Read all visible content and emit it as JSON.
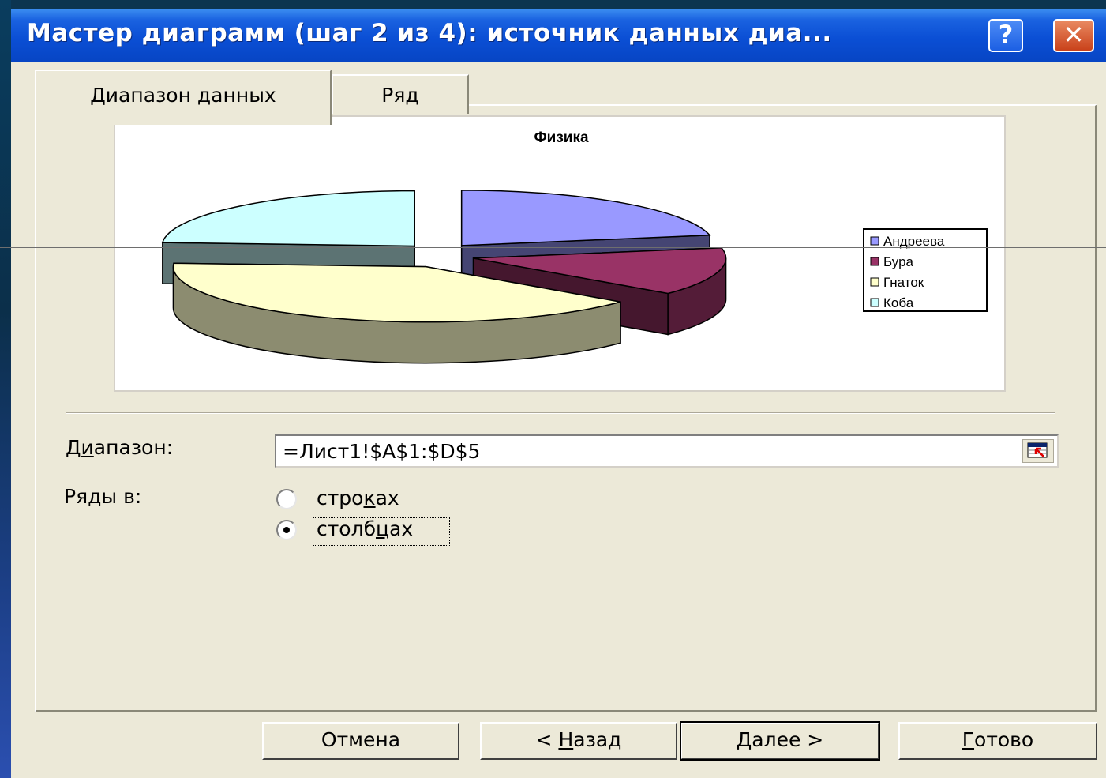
{
  "window": {
    "title": "Мастер диаграмм (шаг 2 из 4): источник данных диа...",
    "help_glyph": "?",
    "close_glyph": "✕"
  },
  "tabs": [
    {
      "label": "Диапазон данных",
      "active": true
    },
    {
      "label": "Ряд",
      "active": false
    }
  ],
  "chart_data": {
    "type": "pie",
    "title": "Физика",
    "style": "3d-exploded",
    "legend_position": "right",
    "slices": [
      {
        "name": "Андреева",
        "value": 22,
        "color": "#9999ff"
      },
      {
        "name": "Бура",
        "value": 14,
        "color": "#993366"
      },
      {
        "name": "Гнаток",
        "value": 40,
        "color": "#ffffcc"
      },
      {
        "name": "Коба",
        "value": 24,
        "color": "#ccffff"
      }
    ]
  },
  "form": {
    "range_label_pre": "Д",
    "range_label_u": "и",
    "range_label_post": "апазон:",
    "range_value": "=Лист1!$A$1:$D$5",
    "series_label": "Ряды в:",
    "options": [
      {
        "pre": "стро",
        "u": "к",
        "post": "ах",
        "selected": false
      },
      {
        "pre": "столб",
        "u": "ц",
        "post": "ах",
        "selected": true
      }
    ]
  },
  "buttons": {
    "cancel": "Отмена",
    "back_pre": "< ",
    "back_u": "Н",
    "back_post": "азад",
    "next_u": "Д",
    "next_post": "алее >",
    "finish_u": "Г",
    "finish_post": "отово"
  }
}
